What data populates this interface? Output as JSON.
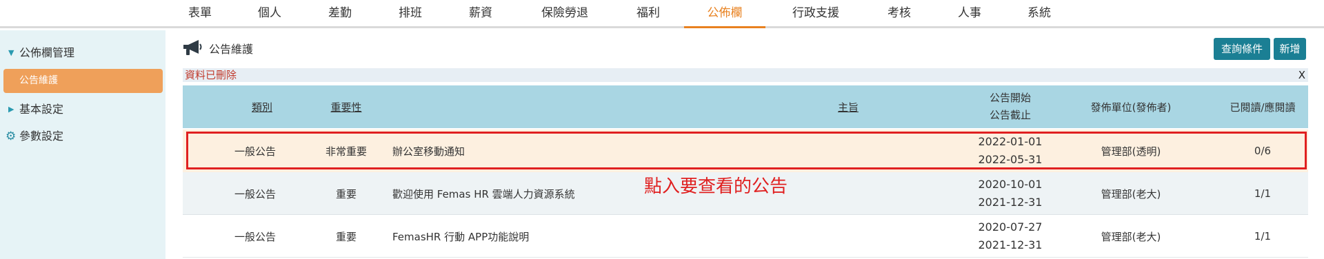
{
  "topnav": {
    "items": [
      "表單",
      "個人",
      "差勤",
      "排班",
      "薪資",
      "保險勞退",
      "福利",
      "公佈欄",
      "行政支援",
      "考核",
      "人事",
      "系統"
    ],
    "active_index": 7
  },
  "sidebar": {
    "section1": "公佈欄管理",
    "active_item": "公告維護",
    "section2": "基本設定",
    "section3": "參數設定"
  },
  "page": {
    "title": "公告維護",
    "query_button": "查詢條件",
    "add_button": "新增"
  },
  "alert": {
    "message": "資料已刪除",
    "close": "X"
  },
  "table": {
    "headers": {
      "category": "類別",
      "importance": "重要性",
      "subject": "主旨",
      "start": "公告開始",
      "end": "公告截止",
      "publisher": "發佈單位(發佈者)",
      "read": "已閱讀/應閱讀"
    },
    "rows": [
      {
        "category": "一般公告",
        "importance": "非常重要",
        "subject": "辦公室移動通知",
        "start": "2022-01-01",
        "end": "2022-05-31",
        "publisher": "管理部(透明)",
        "read": "0/6"
      },
      {
        "category": "一般公告",
        "importance": "重要",
        "subject": "歡迎使用 Femas HR 雲端人力資源系統",
        "start": "2020-10-01",
        "end": "2021-12-31",
        "publisher": "管理部(老大)",
        "read": "1/1"
      },
      {
        "category": "一般公告",
        "importance": "重要",
        "subject": "FemasHR 行動 APP功能說明",
        "start": "2020-07-27",
        "end": "2021-12-31",
        "publisher": "管理部(老大)",
        "read": "1/1"
      }
    ]
  },
  "annotation": "點入要查看的公告",
  "colors": {
    "accent": "#e8811f",
    "header_bg": "#a9d6e3",
    "button_bg": "#1b7f94",
    "highlight": "#e02020"
  }
}
